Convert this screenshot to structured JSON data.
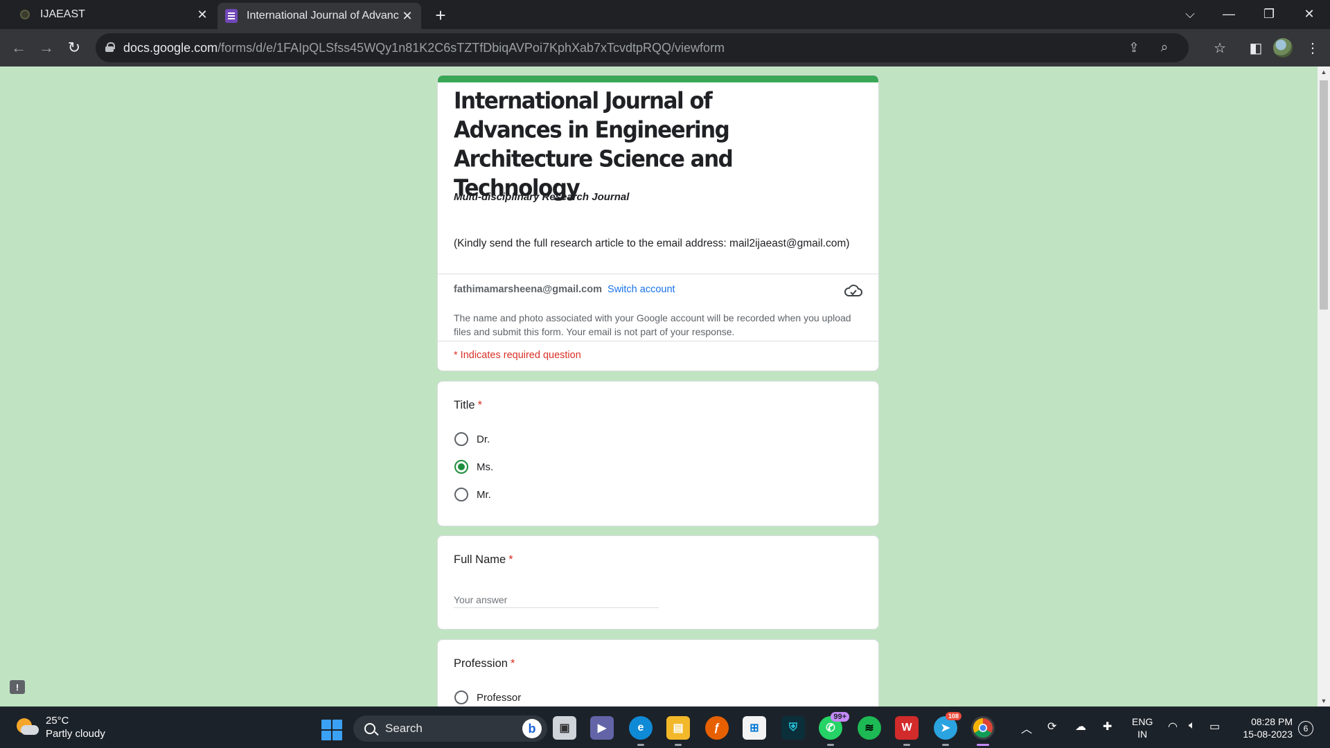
{
  "browser": {
    "tabs": [
      {
        "title": "IJAEAST",
        "active": false
      },
      {
        "title": "International Journal of Advances in Engineering Architecture Science and Technology",
        "active": true
      }
    ],
    "url_host": "docs.google.com",
    "url_path": "/forms/d/e/1FAIpQLSfss45WQy1n81K2C6sTZTfDbiqAVPoi7KphXab7xTcvdtpRQQ/viewform",
    "icons": [
      "back-icon",
      "forward-icon",
      "reload-icon",
      "lock-icon",
      "zoom-icon",
      "share-icon",
      "bookmark-star-icon",
      "side-panel-icon",
      "profile-avatar",
      "menu-kebab-icon"
    ]
  },
  "form": {
    "title": "International Journal of Advances in Engineering Architecture Science and Technology",
    "subtitle": "Multi-disciplinary Research Journal",
    "description": "(Kindly send the full research article to the email address: mail2ijaeast@gmail.com)",
    "account_email": "fathimamarsheena@gmail.com",
    "switch_account": "Switch account",
    "privacy_note": "The name and photo associated with your Google account will be recorded when you upload files and submit this form. Your email is not part of your response.",
    "required_note": "* Indicates required question",
    "accent_color": "#3aa757",
    "background_color": "#c0e4c2"
  },
  "questions": {
    "title_q": {
      "label": "Title",
      "required_mark": "*",
      "options": [
        "Dr.",
        "Ms.",
        "Mr."
      ],
      "selected": "Ms."
    },
    "full_name": {
      "label": "Full Name",
      "required_mark": "*",
      "placeholder": "Your answer",
      "value": ""
    },
    "profession": {
      "label": "Profession",
      "required_mark": "*",
      "options_visible": [
        "Professor"
      ]
    }
  },
  "taskbar": {
    "temperature": "25°C",
    "weather": "Partly cloudy",
    "search_label": "Search",
    "whatsapp_badge": "99+",
    "telegram_badge": "108",
    "lang_line1": "ENG",
    "lang_line2": "IN",
    "time": "08:28 PM",
    "date": "15-08-2023",
    "notification_count": "6"
  }
}
